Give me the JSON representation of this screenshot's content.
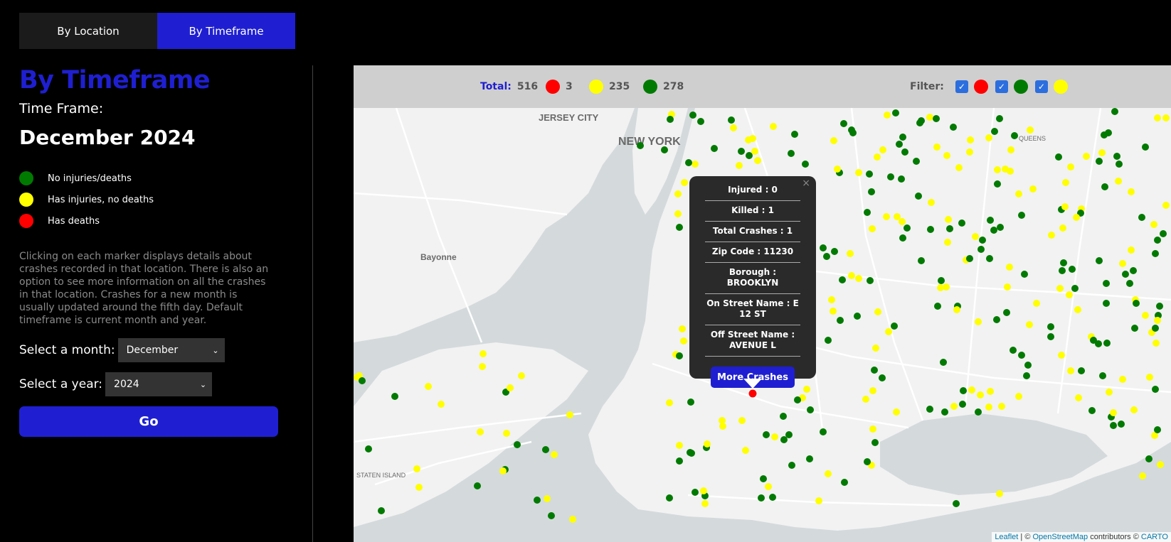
{
  "tabs": [
    {
      "label": "By Location",
      "active": false
    },
    {
      "label": "By Timeframe",
      "active": true
    }
  ],
  "sidebar": {
    "title": "By Timeframe",
    "timeframe_label": "Time Frame:",
    "timeframe_value": "December 2024",
    "legend": [
      {
        "label": "No injuries/deaths",
        "color": "#007a00"
      },
      {
        "label": "Has injuries, no deaths",
        "color": "#ffff00"
      },
      {
        "label": "Has deaths",
        "color": "#ff0000"
      }
    ],
    "description": "Clicking on each marker displays details about crashes recorded in that location. There is also an option to see more information on all the crashes in that location. Crashes for a new month is usually updated around the fifth day. Default timeframe is current month and year.",
    "month_label": "Select a month:",
    "month_value": "December",
    "year_label": "Select a year:",
    "year_value": "2024",
    "go_label": "Go"
  },
  "stats": {
    "total_label": "Total:",
    "total": "516",
    "red_count": "3",
    "yellow_count": "235",
    "green_count": "278",
    "filter_label": "Filter:"
  },
  "colors": {
    "red": "#ff0000",
    "yellow": "#ffff00",
    "green": "#007a00",
    "accent": "#1f1fd1"
  },
  "popup": {
    "rows": [
      "Injured : 0",
      "Killed : 1",
      "Total Crashes : 1",
      "Zip Code : 11230",
      "Borough : BROOKLYN",
      "On Street Name : E 12 ST",
      "Off Street Name : AVENUE L"
    ],
    "button_label": "More Crashes",
    "close": "×"
  },
  "map_labels": [
    "JERSEY CITY",
    "NEW YORK",
    "Bayonne",
    "QUEENS",
    "STATEN ISLAND"
  ],
  "attribution": {
    "leaflet": "Leaflet",
    "sep": " | © ",
    "osm": "OpenStreetMap",
    "contrib": " contributors © ",
    "carto": "CARTO"
  }
}
